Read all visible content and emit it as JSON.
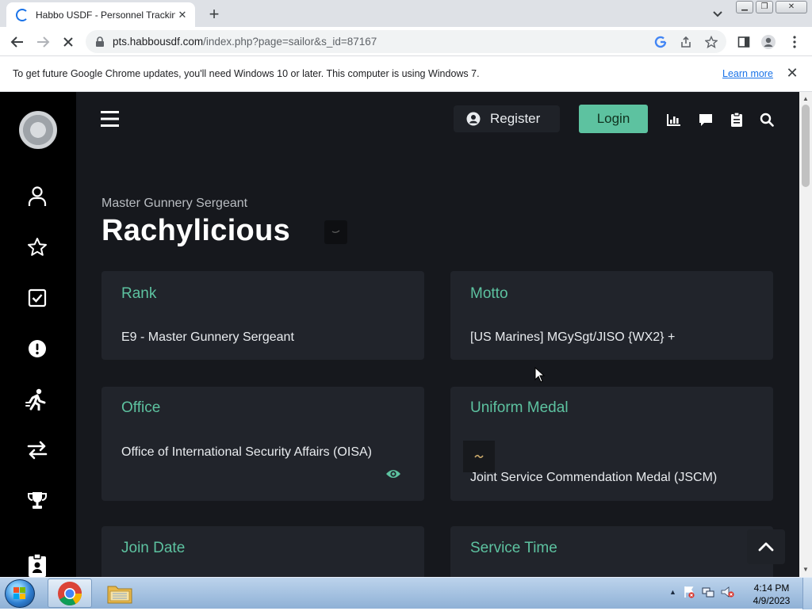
{
  "browser": {
    "tab_title": "Habbo USDF - Personnel Tracking",
    "url_host": "pts.habbousdf.com",
    "url_path": "/index.php?page=sailor&s_id=87167",
    "infobar_text": "To get future Google Chrome updates, you'll need Windows 10 or later. This computer is using Windows 7.",
    "infobar_link": "Learn more"
  },
  "topnav": {
    "register": "Register",
    "login": "Login"
  },
  "profile": {
    "rank_title": "Master Gunnery Sergeant",
    "name": "Rachylicious"
  },
  "cards": {
    "rank": {
      "label": "Rank",
      "value": "E9 - Master Gunnery Sergeant"
    },
    "motto": {
      "label": "Motto",
      "value": "[US Marines] MGySgt/JISO {WX2} +"
    },
    "office": {
      "label": "Office",
      "value": "Office of International Security Affairs (OISA)"
    },
    "uniform_medal": {
      "label": "Uniform Medal",
      "value": "Joint Service Commendation Medal (JSCM)"
    },
    "join_date": {
      "label": "Join Date"
    },
    "service_time": {
      "label": "Service Time"
    }
  },
  "taskbar": {
    "time": "4:14 PM",
    "date": "4/9/2023"
  },
  "colors": {
    "accent": "#5dc2a0",
    "page_bg": "#16181d",
    "card_bg": "#21242b",
    "sidebar_bg": "#000000"
  },
  "icons": {
    "sidebar": [
      "user-icon",
      "star-icon",
      "check-square-icon",
      "alert-circle-icon",
      "running-person-icon",
      "swap-arrows-icon",
      "trophy-icon",
      "id-badge-icon"
    ],
    "topnav": [
      "menu-icon",
      "user-circle-icon",
      "bar-chart-icon",
      "chat-icon",
      "clipboard-icon",
      "search-icon"
    ]
  }
}
